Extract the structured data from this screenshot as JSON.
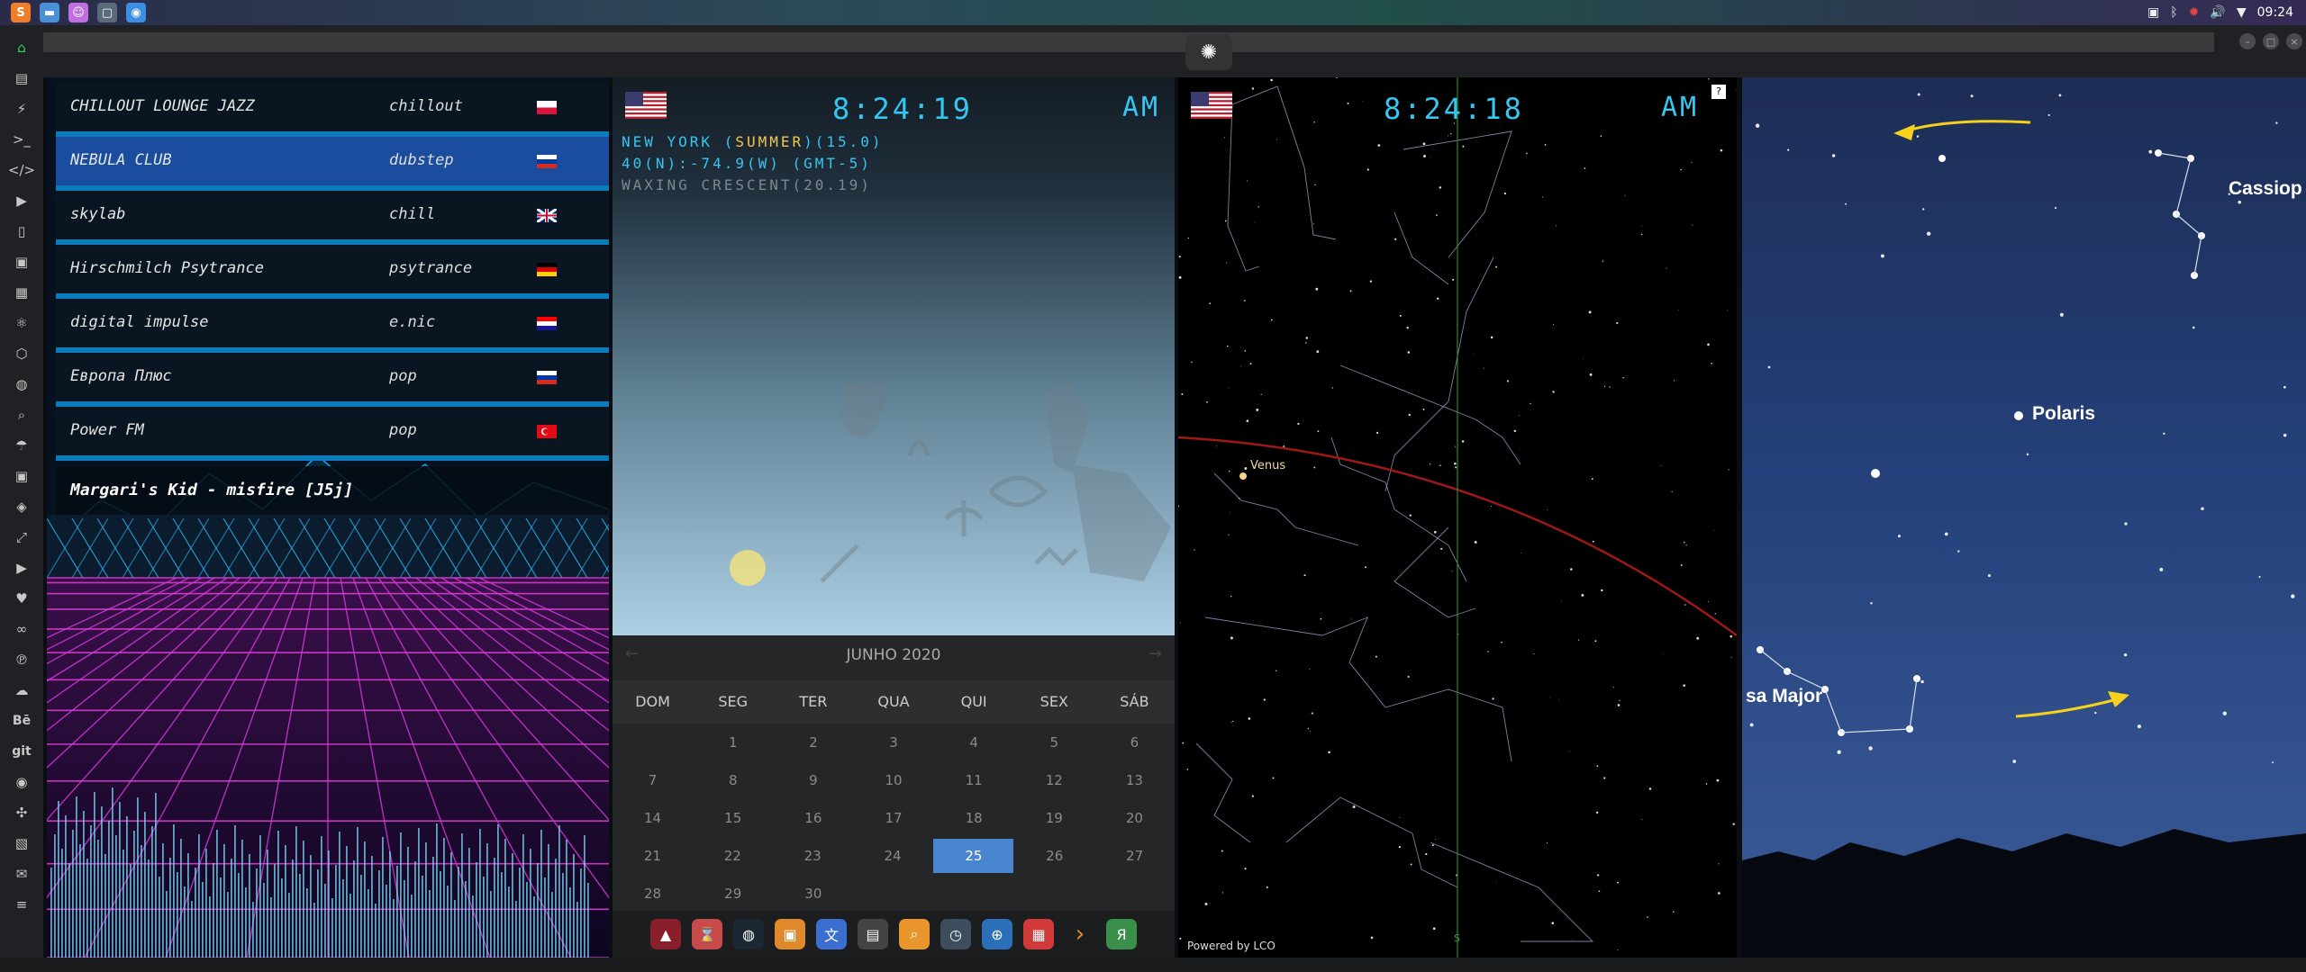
{
  "taskbar": {
    "clock": "09:24",
    "apps": [
      {
        "icon": "sublime-text-icon",
        "color": "#ef7d2a",
        "glyph": "S"
      },
      {
        "icon": "files-icon",
        "color": "#4a90d9",
        "glyph": "▬"
      },
      {
        "icon": "discord-icon",
        "color": "#c16ee0",
        "glyph": "☺"
      },
      {
        "icon": "window-icon",
        "color": "#5a6a7a",
        "glyph": "▢"
      },
      {
        "icon": "chrome-icon",
        "color": "#3b8ee4",
        "glyph": "◉"
      }
    ],
    "tray": [
      "photo-icon",
      "bluetooth-icon",
      "settings-alert-icon",
      "volume-icon",
      "wifi-icon"
    ]
  },
  "window": {
    "logo_icon": "rebel-alliance-icon",
    "controls": [
      "minimize",
      "maximize",
      "close"
    ]
  },
  "launcher": [
    "home-icon",
    "document-icon",
    "bolt-icon",
    "terminal-icon",
    "code-icon",
    "play-icon",
    "phone-icon",
    "image-icon",
    "news-icon",
    "react-icon",
    "hexagon-icon",
    "globe-icon",
    "search-icon",
    "umbrella-icon",
    "contact-icon",
    "tag-icon",
    "expand-icon",
    "youtube-icon",
    "heart-icon",
    "infinity-icon",
    "pinterest-icon",
    "cloud-icon",
    "behance-icon",
    "git-icon",
    "github-icon",
    "puzzle-icon",
    "map-icon",
    "mail-icon",
    "settings-icon"
  ],
  "launcher_labels": {
    "behance": "Bē",
    "git": "git"
  },
  "radio": {
    "stations": [
      {
        "name": "CHILLOUT LOUNGE JAZZ",
        "genre": "chillout",
        "flag": "poland"
      },
      {
        "name": "NEBULA CLUB",
        "genre": "dubstep",
        "flag": "russia",
        "selected": true
      },
      {
        "name": "skylab",
        "genre": "chill",
        "flag": "uk"
      },
      {
        "name": "Hirschmilch Psytrance",
        "genre": "psytrance",
        "flag": "germany"
      },
      {
        "name": "digital impulse",
        "genre": "e.nic",
        "flag": "croatia"
      },
      {
        "name": "Европа Плюс",
        "genre": "pop",
        "flag": "russia"
      },
      {
        "name": "Power FM",
        "genre": "pop",
        "flag": "turkey"
      }
    ],
    "now_playing": "Margari's Kid - misfire [J5j]"
  },
  "clock_panel": {
    "time": "8:24:19",
    "ampm": "AM",
    "location_pre": "NEW YORK (",
    "season": "SUMMER",
    "location_post": ")(15.0)",
    "coords": "40(N):-74.9(W) (GMT-5)",
    "moon": "WAXING CRESCENT(20.19)"
  },
  "calendar": {
    "month": "JUNHO 2020",
    "prev": "←",
    "next": "→",
    "weekdays": [
      "DOM",
      "SEG",
      "TER",
      "QUA",
      "QUI",
      "SEX",
      "SÁB"
    ],
    "weeks": [
      [
        "",
        "1",
        "2",
        "3",
        "4",
        "5",
        "6"
      ],
      [
        "7",
        "8",
        "9",
        "10",
        "11",
        "12",
        "13"
      ],
      [
        "14",
        "15",
        "16",
        "17",
        "18",
        "19",
        "20"
      ],
      [
        "21",
        "22",
        "23",
        "24",
        "25",
        "26",
        "27"
      ],
      [
        "28",
        "29",
        "30",
        "",
        "",
        "",
        ""
      ]
    ],
    "today": "25"
  },
  "dock": [
    {
      "icon": "arrow-app-icon",
      "color": "#8a1f2b",
      "glyph": "▲"
    },
    {
      "icon": "timer-icon",
      "color": "#c94a4a",
      "glyph": "⌛"
    },
    {
      "icon": "earth-icon",
      "color": "#1b2733",
      "glyph": "◍"
    },
    {
      "icon": "image-viewer-icon",
      "color": "#e0892a",
      "glyph": "▣"
    },
    {
      "icon": "translate-icon",
      "color": "#3a6fd0",
      "glyph": "文"
    },
    {
      "icon": "terminal-icon",
      "color": "#444",
      "glyph": "▤"
    },
    {
      "icon": "search-app-icon",
      "color": "#e8962b",
      "glyph": "⌕"
    },
    {
      "icon": "clock-app-icon",
      "color": "#3c4d5e",
      "glyph": "◷"
    },
    {
      "icon": "globe-app-icon",
      "color": "#2a6fb8",
      "glyph": "⊕"
    },
    {
      "icon": "calendar-app-icon",
      "color": "#d23a3a",
      "glyph": "▦"
    },
    {
      "icon": "arrow-right-icon",
      "color": "#1c1d1f",
      "glyph": "›"
    },
    {
      "icon": "yandex-icon",
      "color": "#3a8f4a",
      "glyph": "Я"
    }
  ],
  "starmap": {
    "time": "8:24:18",
    "ampm": "AM",
    "help": "?",
    "venus": "Venus",
    "south": "S",
    "powered": "Powered by LCO"
  },
  "sky": {
    "cassiopeia": "Cassiop",
    "polaris": "Polaris",
    "ursa": "sa Major"
  }
}
